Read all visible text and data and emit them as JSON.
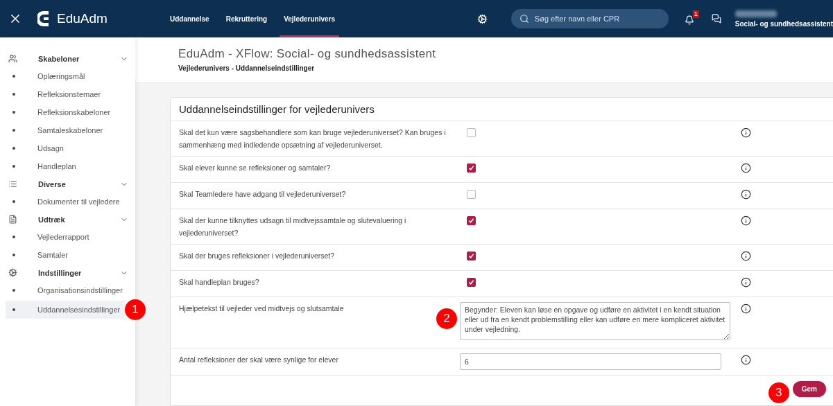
{
  "header": {
    "logo": "EduAdm",
    "nav": [
      {
        "label": "Uddannelse",
        "selected": false
      },
      {
        "label": "Rekruttering",
        "selected": false
      },
      {
        "label": "Vejlederunivers",
        "selected": true
      }
    ],
    "search": {
      "placeholder": "Søg efter navn eller CPR"
    },
    "notification_count": "1",
    "role": "Social- og sundhedsassistent"
  },
  "sidebar": {
    "groups": [
      {
        "title": "Skabeloner",
        "expanded": true,
        "items": [
          {
            "label": "Oplæringsmål",
            "selected": false
          },
          {
            "label": "Refleksionstemaer",
            "selected": false
          },
          {
            "label": "Refleksionskabeloner",
            "selected": false
          },
          {
            "label": "Samtaleskabeloner",
            "selected": false
          },
          {
            "label": "Udsagn",
            "selected": false
          },
          {
            "label": "Handleplan",
            "selected": false
          }
        ]
      },
      {
        "title": "Diverse",
        "expanded": true,
        "items": [
          {
            "label": "Dokumenter til vejledere",
            "selected": false
          }
        ]
      },
      {
        "title": "Udtræk",
        "expanded": true,
        "items": [
          {
            "label": "Vejlederrapport",
            "selected": false
          },
          {
            "label": "Samtaler",
            "selected": false
          }
        ]
      },
      {
        "title": "Indstillinger",
        "expanded": true,
        "items": [
          {
            "label": "Organisationsindstillinger",
            "selected": false
          },
          {
            "label": "Uddannelsesindstillinger",
            "selected": true
          }
        ]
      }
    ]
  },
  "page": {
    "title": "EduAdm - XFlow: Social- og sundhedsassistent",
    "breadcrumb": "Vejlederunivers - Uddannelseindstillinger"
  },
  "card": {
    "title": "Uddannelseindstillinger for vejlederunivers",
    "rows": [
      {
        "kind": "checkbox",
        "label": "Skal det kun være sagsbehandlere som kan bruge vejlederuniverset? Kan bruges i sammenhæng med indledende opsætning af vejlederuniverset.",
        "checked": false
      },
      {
        "kind": "checkbox",
        "label": "Skal elever kunne se refleksioner og samtaler?",
        "checked": true
      },
      {
        "kind": "checkbox",
        "label": "Skal Teamledere have adgang til vejlederuniverset?",
        "checked": false
      },
      {
        "kind": "checkbox",
        "label": "Skal der kunne tilknyttes udsagn til midtvejssamtale og slutevaluering i vejlederuniverset?",
        "checked": true
      },
      {
        "kind": "checkbox",
        "label": "Skal der bruges refleksioner i vejlederuniverset?",
        "checked": true
      },
      {
        "kind": "checkbox",
        "label": "Skal handleplan bruges?",
        "checked": true
      },
      {
        "kind": "textarea",
        "label": "Hjælpetekst til vejleder ved midtvejs og slutsamtale",
        "value": "Begynder: Eleven kan løse en opgave og udføre en aktivitet i en kendt situation eller ud fra en kendt problemstilling eller kan udføre en mere kompliceret aktivitet under vejledning."
      },
      {
        "kind": "input",
        "label": "Antal refleksioner der skal være synlige for elever",
        "value": "6"
      }
    ],
    "save_button": "Gem"
  },
  "annotations": [
    "1",
    "2",
    "3"
  ]
}
